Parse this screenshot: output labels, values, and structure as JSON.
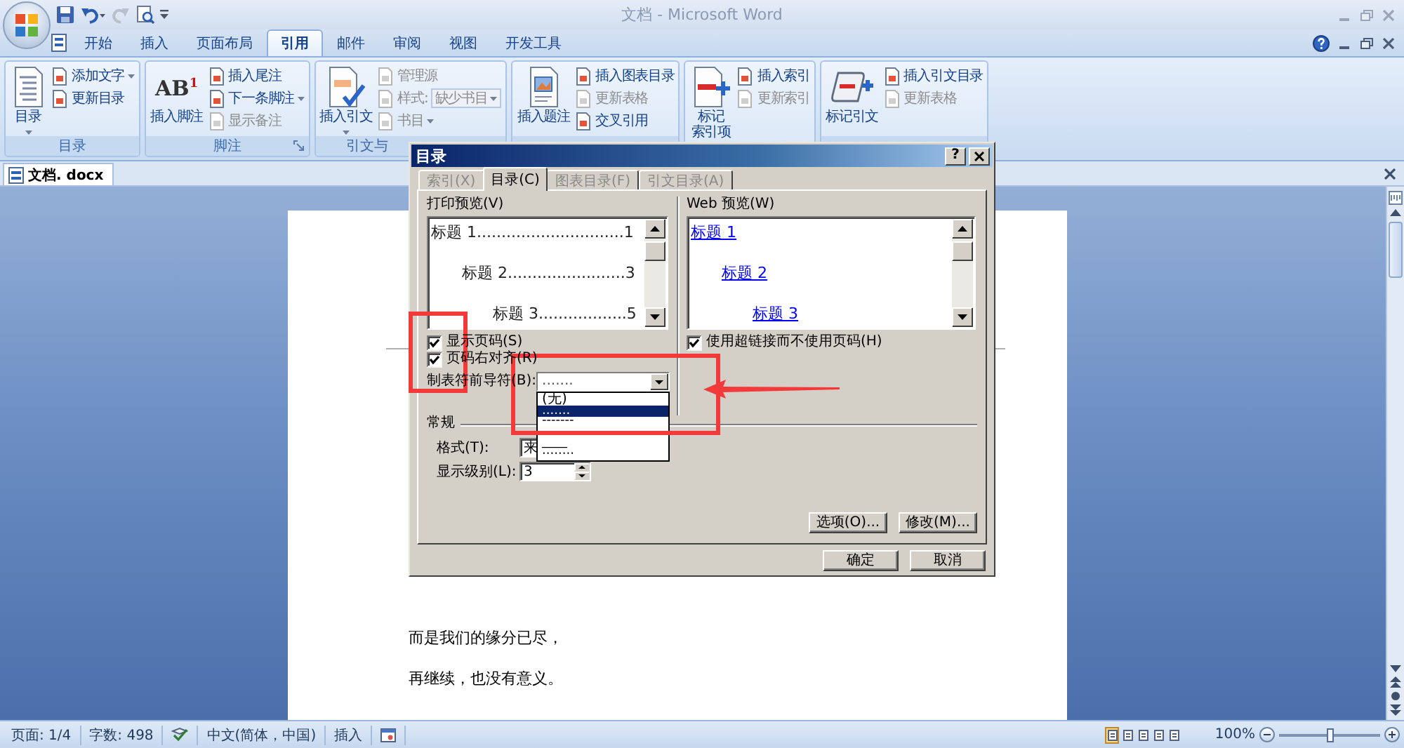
{
  "window": {
    "title": "文档 - Microsoft Word"
  },
  "quick_access": [
    {
      "kind": "save",
      "disabled": false
    },
    {
      "kind": "undo",
      "disabled": false
    },
    {
      "kind": "redo",
      "disabled": true
    },
    {
      "kind": "print_preview",
      "disabled": false
    }
  ],
  "ribbon_tabs": [
    {
      "label": "开始",
      "selected": false
    },
    {
      "label": "插入",
      "selected": false
    },
    {
      "label": "页面布局",
      "selected": false
    },
    {
      "label": "引用",
      "selected": true
    },
    {
      "label": "邮件",
      "selected": false
    },
    {
      "label": "审阅",
      "selected": false
    },
    {
      "label": "视图",
      "selected": false
    },
    {
      "label": "开发工具",
      "selected": false
    }
  ],
  "ribbon_groups": [
    {
      "label": "目录",
      "launcher": false,
      "large": {
        "lines": [
          "目录"
        ],
        "dropdown": true
      },
      "small": [
        {
          "kind": "button",
          "label": "添加文字",
          "dropdown": true,
          "disabled": false
        },
        {
          "kind": "button",
          "label": "更新目录",
          "dropdown": false,
          "disabled": false
        }
      ]
    },
    {
      "label": "脚注",
      "launcher": true,
      "large": {
        "glyph": "AB$^{1}$",
        "lines": [
          "插入脚注"
        ],
        "dropdown": false
      },
      "small": [
        {
          "kind": "button",
          "label": "插入尾注",
          "dropdown": false,
          "disabled": false
        },
        {
          "kind": "button",
          "label": "下一条脚注",
          "dropdown": true,
          "disabled": false
        },
        {
          "kind": "button",
          "label": "显示备注",
          "dropdown": false,
          "disabled": true
        }
      ]
    },
    {
      "label": "引文与",
      "launcher": false,
      "large": {
        "lines": [
          "插入引文"
        ],
        "dropdown": true
      },
      "small": [
        {
          "kind": "button",
          "label": "管理源",
          "dropdown": false,
          "disabled": true
        },
        {
          "kind": "combo",
          "label": "样式:",
          "value": "缺少书目",
          "disabled": true
        },
        {
          "kind": "button",
          "label": "书目",
          "dropdown": true,
          "disabled": true
        }
      ]
    },
    {
      "large": {
        "lines": [
          "插入题注"
        ],
        "dropdown": false
      },
      "small": [
        {
          "kind": "button",
          "label": "插入图表目录",
          "dropdown": false,
          "disabled": false
        },
        {
          "kind": "button",
          "label": "更新表格",
          "dropdown": false,
          "disabled": true
        },
        {
          "kind": "button",
          "label": "交叉引用",
          "dropdown": false,
          "disabled": false
        }
      ]
    },
    {
      "large": {
        "lines": [
          "标记",
          "索引项"
        ],
        "dropdown": false
      },
      "small": [
        {
          "kind": "button",
          "label": "插入索引",
          "dropdown": false,
          "disabled": false
        },
        {
          "kind": "button",
          "label": "更新索引",
          "dropdown": false,
          "disabled": true
        }
      ]
    },
    {
      "large": {
        "lines": [
          "标记引文"
        ],
        "dropdown": false
      },
      "small": [
        {
          "kind": "button",
          "label": "插入引文目录",
          "dropdown": false,
          "disabled": false
        },
        {
          "kind": "button",
          "label": "更新表格",
          "dropdown": false,
          "disabled": true
        }
      ]
    }
  ],
  "doc_tab": {
    "label": "文档. docx"
  },
  "document": {
    "paragraphs": [
      "而是我们的缘分已尽，",
      "再继续，也没有意义。"
    ]
  },
  "dialog": {
    "title": "目录",
    "help": "?",
    "tabs": [
      {
        "label": "索引(X)",
        "selected": false
      },
      {
        "label": "目录(C)",
        "selected": true
      },
      {
        "label": "图表目录(F)",
        "selected": false
      },
      {
        "label": "引文目录(A)",
        "selected": false
      }
    ],
    "print_preview": {
      "label": "打印预览(V)",
      "entries": [
        {
          "text": "标题 1..............................1",
          "children": [
            {
              "text": "标题 2........................3",
              "children": [
                {
                  "text": "标题 3..................5"
                }
              ]
            }
          ]
        }
      ]
    },
    "web_preview": {
      "label": "Web 预览(W)",
      "entries": [
        {
          "text": "标题 1",
          "children": [
            {
              "text": "标题 2",
              "children": [
                {
                  "text": "标题 3"
                }
              ]
            }
          ]
        }
      ]
    },
    "options": [
      {
        "label": "显示页码(S)",
        "checked": true
      },
      {
        "label": "页码右对齐(R)",
        "checked": true
      }
    ],
    "web_option": {
      "label": "使用超链接而不使用页码(H)",
      "checked": true
    },
    "tab_leader": {
      "label": "制表符前导符(B):",
      "value": ".......",
      "expanded": true,
      "options": [
        {
          "label": "(无)",
          "selected": false
        },
        {
          "label": ".......",
          "selected": true
        },
        {
          "label": "-------",
          "selected": false
        },
        {
          "label": "____",
          "selected": false
        },
        {
          "label": "········",
          "selected": false
        }
      ]
    },
    "general": {
      "label": "常规",
      "format": {
        "label": "格式(T):",
        "value": "来"
      },
      "levels": {
        "label": "显示级别(L):",
        "value": "3"
      }
    },
    "panel_buttons": [
      "选项(O)...",
      "修改(M)..."
    ],
    "buttons": [
      "确定",
      "取消"
    ]
  },
  "status_bar": {
    "page": "页面: 1/4",
    "words": "字数: 498",
    "language": "中文(简体，中国)",
    "mode": "插入",
    "views": [
      {
        "selected": true
      },
      {
        "selected": false
      },
      {
        "selected": false
      },
      {
        "selected": false
      },
      {
        "selected": false
      }
    ],
    "zoom": {
      "label": "100%",
      "level": 0.5
    }
  }
}
